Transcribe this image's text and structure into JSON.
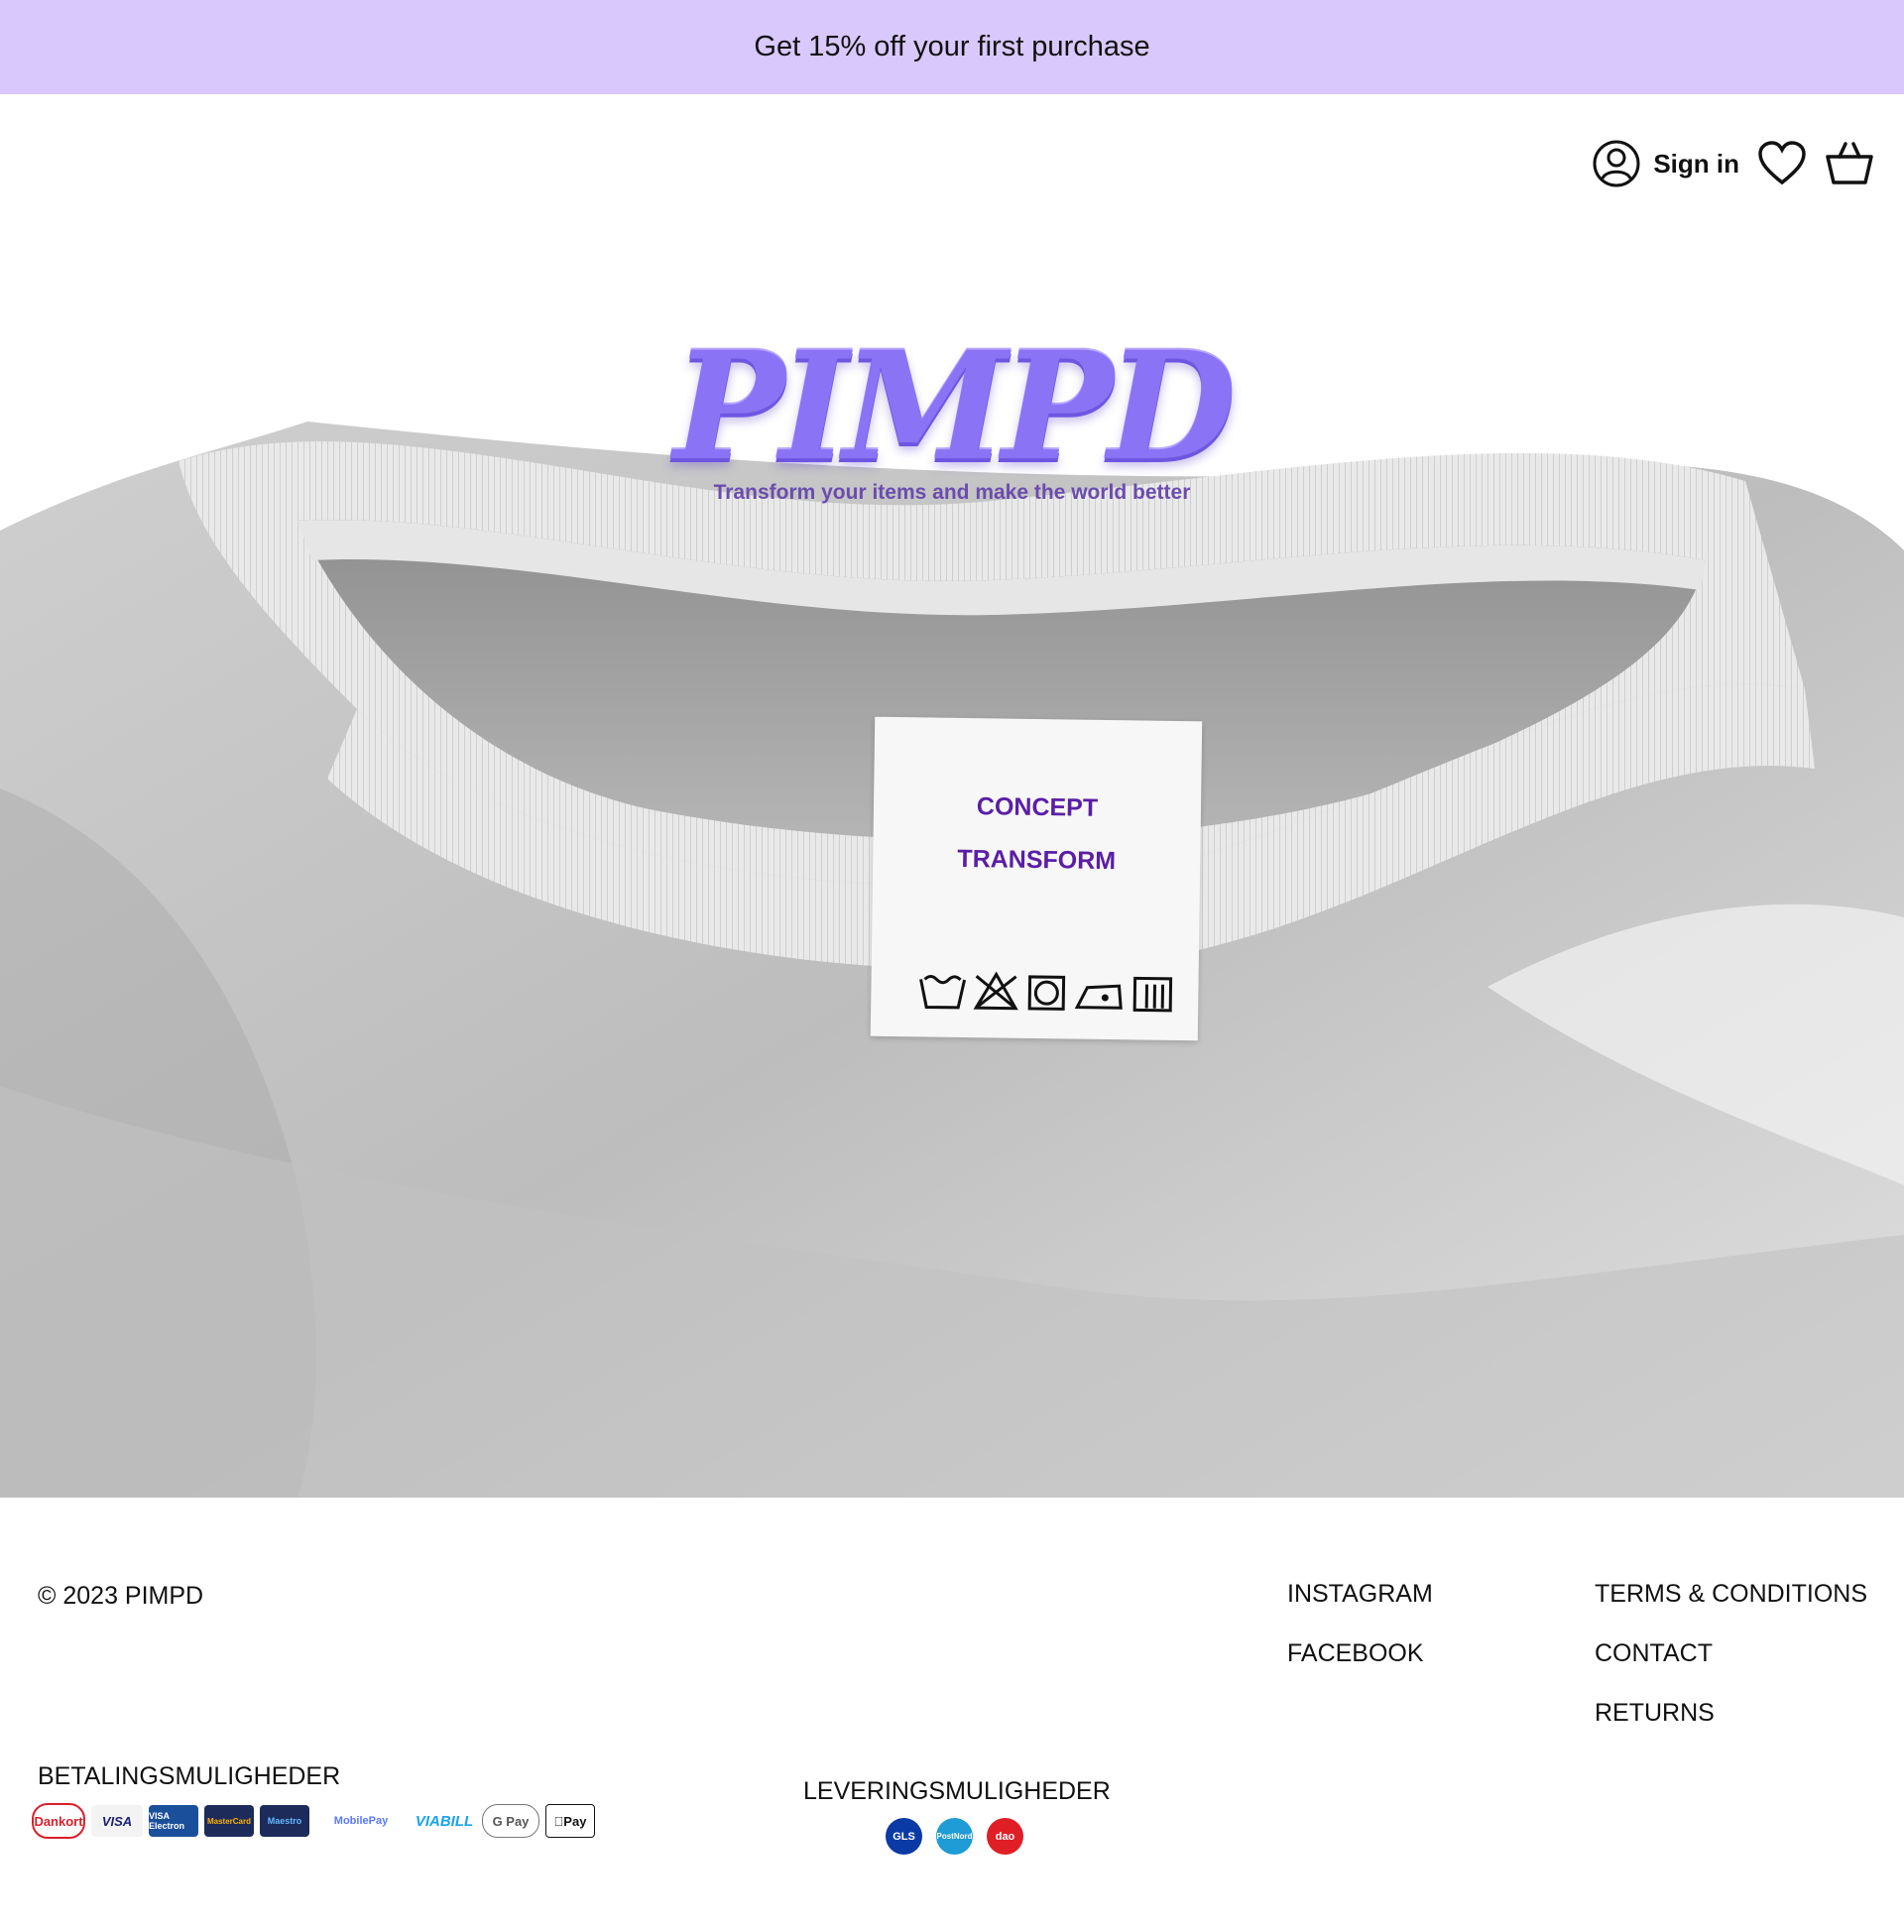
{
  "announcement": {
    "text": "Get 15% off your first purchase",
    "bg": "#d8c8fb"
  },
  "header": {
    "signin_label": "Sign in",
    "icons": [
      "user-icon",
      "heart-icon",
      "basket-icon"
    ]
  },
  "hero": {
    "logo_text": "PIMPD",
    "tagline": "Transform your items and make the world better",
    "label_lines": [
      "CONCEPT",
      "TRANSFORM"
    ],
    "care_icons": [
      "wash-icon",
      "no-bleach-icon",
      "tumble-dry-icon",
      "iron-icon",
      "dry-clean-icon"
    ]
  },
  "footer": {
    "copyright": "© 2023 PIMPD",
    "social_links": [
      "INSTAGRAM",
      "FACEBOOK"
    ],
    "info_links": [
      "TERMS & CONDITIONS",
      "CONTACT",
      "RETURNS"
    ],
    "payment_title": "BETALINGSMULIGHEDER",
    "payment_methods": [
      "Dankort",
      "VISA",
      "VISA Electron",
      "MasterCard",
      "Maestro",
      "MobilePay",
      "VIABILL",
      "G Pay",
      "Pay"
    ],
    "shipping_title": "LEVERINGSMULIGHEDER",
    "shipping_methods": [
      "GLS",
      "PostNord",
      "dao"
    ]
  },
  "colors": {
    "accent": "#8b73f6",
    "label_text": "#5a1ea6",
    "tagline": "#6a4cae"
  }
}
